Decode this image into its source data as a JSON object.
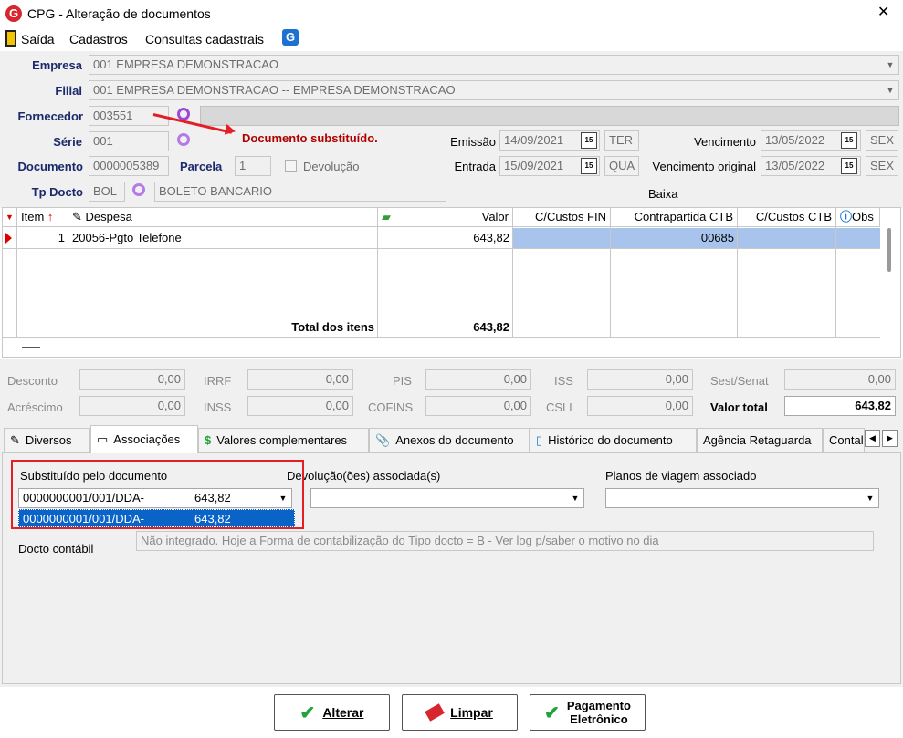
{
  "window": {
    "title": "CPG - Alteração de documentos",
    "close": "✕"
  },
  "menu": {
    "items": [
      "Saída",
      "Cadastros",
      "Consultas cadastrais"
    ]
  },
  "form": {
    "empresa": {
      "label": "Empresa",
      "value": "001 EMPRESA DEMONSTRACAO"
    },
    "filial": {
      "label": "Filial",
      "value": "001 EMPRESA DEMONSTRACAO -- EMPRESA DEMONSTRACAO"
    },
    "fornecedor": {
      "label": "Fornecedor",
      "value": "003551"
    },
    "serie": {
      "label": "Série",
      "value": "001"
    },
    "substituido_msg": "Documento substituído.",
    "documento": {
      "label": "Documento",
      "value": "0000005389"
    },
    "parcela": {
      "label": "Parcela",
      "value": "1"
    },
    "devolucao": {
      "label": "Devolução"
    },
    "tp_docto": {
      "label": "Tp Docto",
      "code": "BOL",
      "desc": "BOLETO BANCARIO"
    },
    "emissao": {
      "label": "Emissão",
      "date": "14/09/2021",
      "day": "TER"
    },
    "entrada": {
      "label": "Entrada",
      "date": "15/09/2021",
      "day": "QUA"
    },
    "vencimento": {
      "label": "Vencimento",
      "date": "13/05/2022",
      "day": "SEX"
    },
    "vencimento_original": {
      "label": "Vencimento original",
      "date": "13/05/2022",
      "day": "SEX"
    },
    "baixa": {
      "label": "Baixa"
    },
    "cal_icon": "15"
  },
  "grid": {
    "headers": {
      "item": "Item",
      "despesa": "Despesa",
      "valor": "Valor",
      "cc_fin": "C/Custos FIN",
      "contrapartida": "Contrapartida CTB",
      "cc_ctb": "C/Custos CTB",
      "obs": "Obs"
    },
    "rows": [
      {
        "item": "1",
        "despesa": "20056-Pgto Telefone",
        "valor": "643,82",
        "cc_fin": "",
        "contrapartida": "00685",
        "cc_ctb": ""
      }
    ],
    "total_label": "Total dos itens",
    "total_value": "643,82"
  },
  "totals": {
    "desconto": {
      "label": "Desconto",
      "value": "0,00"
    },
    "irrf": {
      "label": "IRRF",
      "value": "0,00"
    },
    "pis": {
      "label": "PIS",
      "value": "0,00"
    },
    "iss": {
      "label": "ISS",
      "value": "0,00"
    },
    "sest": {
      "label": "Sest/Senat",
      "value": "0,00"
    },
    "acrescimo": {
      "label": "Acréscimo",
      "value": "0,00"
    },
    "inss": {
      "label": "INSS",
      "value": "0,00"
    },
    "cofins": {
      "label": "COFINS",
      "value": "0,00"
    },
    "csll": {
      "label": "CSLL",
      "value": "0,00"
    },
    "valor_total": {
      "label": "Valor total",
      "value": "643,82"
    }
  },
  "tabs": [
    "Diversos",
    "Associações",
    "Valores complementares",
    "Anexos do documento",
    "Histórico do documento",
    "Agência Retaguarda",
    "Contal"
  ],
  "assoc": {
    "substituido_label": "Substituído pelo documento",
    "substituido_value": "0000000001/001/DDA-",
    "substituido_amount": "643,82",
    "option_value": "0000000001/001/DDA-",
    "option_amount": "643,82",
    "devolucoes_label": "Devolução(ões) associada(s)",
    "planos_label": "Planos de viagem associado",
    "docto_contabil_label": "Docto contábil",
    "docto_contabil_value": "Não integrado. Hoje a Forma de contabilização do Tipo docto = B - Ver log p/saber o motivo no dia"
  },
  "buttons": {
    "alterar": "Alterar",
    "limpar": "Limpar",
    "pagamento_1": "Pagamento",
    "pagamento_2": "Eletrônico"
  },
  "colors": {
    "accent": "#1c2a6c",
    "red": "#b00000",
    "highlight": "#a8c4ec",
    "selection": "#0a64c8",
    "annotation": "#e31e24"
  }
}
